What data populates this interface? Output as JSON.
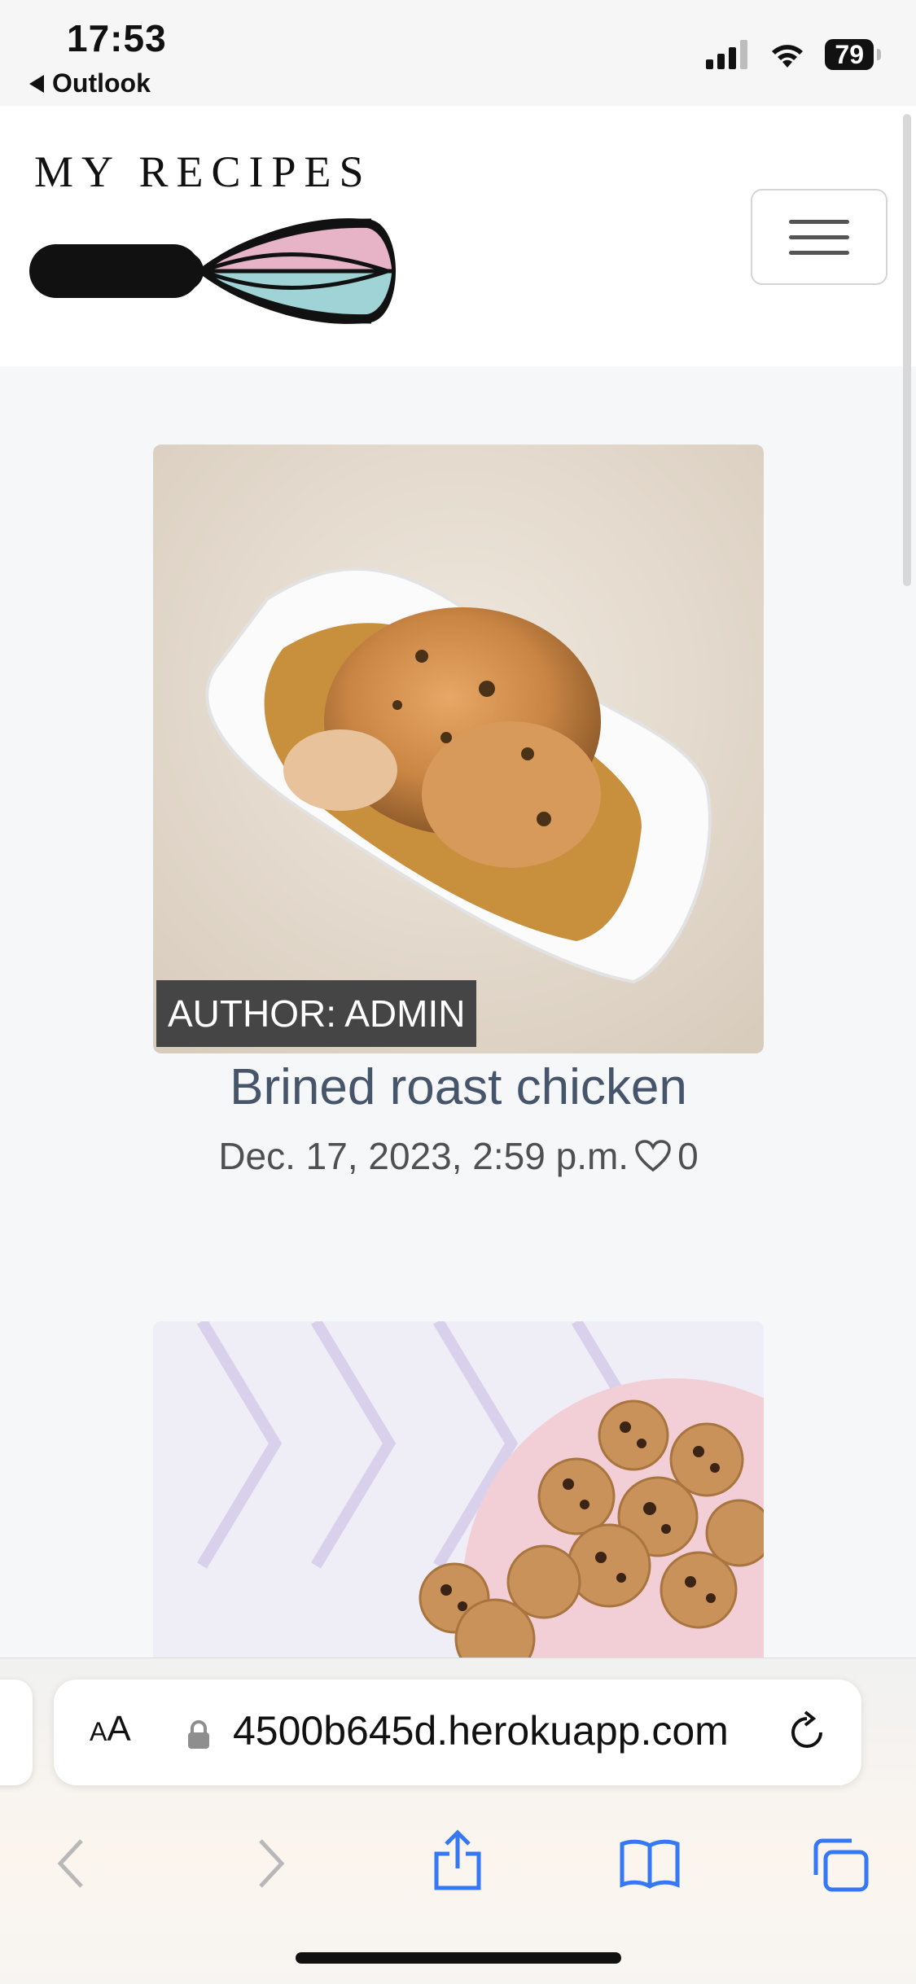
{
  "status_bar": {
    "time": "17:53",
    "back_app": "Outlook",
    "battery": "79"
  },
  "header": {
    "brand": "MY RECIPES",
    "menu_icon": "hamburger-icon"
  },
  "cards": [
    {
      "author": "AUTHOR: ADMIN",
      "title": "Brined roast chicken",
      "date": "Dec. 17, 2023, 2:59 p.m.",
      "likes": "0",
      "image_icon": "roast-chicken-photo"
    },
    {
      "image_icon": "chocolate-chip-cookies-photo"
    }
  ],
  "safari": {
    "aa_label_small": "A",
    "aa_label_large": "A",
    "url": "4500b645d.herokuapp.com"
  },
  "colors": {
    "title": "#46556a",
    "accent": "#3478f6",
    "whisk_pink": "#e6b3c7",
    "whisk_teal": "#9fd3d6"
  }
}
